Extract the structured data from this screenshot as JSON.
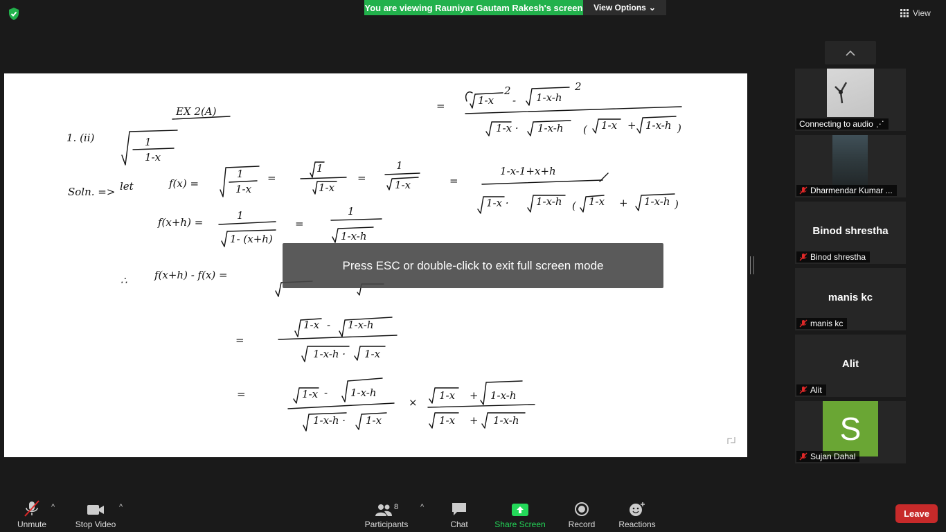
{
  "meeting": {
    "banner_text": "You are viewing Rauniyar Gautam Rakesh's screen",
    "view_options_label": "View Options",
    "view_label": "View",
    "fullscreen_hint": "Press ESC or double-click to exit full screen mode"
  },
  "whiteboard": {
    "title": "EX 2(A)",
    "problem_num": "1. (ii)",
    "expr_given": "√(1/(1-x))",
    "sol_label": "Soln. =>",
    "let_label": "let",
    "lines": [
      "f(x) = √(1/(1-x)) = √1/√(1-x) = 1/√(1-x)",
      "f(x+h) = 1/√(1-(x+h)) = 1/√(1-x-h)",
      "∴ f(x+h) - f(x) = 1/√(1-x-h) - 1/√(1-x)",
      "= (√(1-x) - √(1-x-h)) / (√(1-x-h) · √(1-x))",
      "= (√(1-x) - √(1-x-h))/(√(1-x-h)·√(1-x)) × (√(1-x) + √(1-x-h))/(√(1-x) + √(1-x-h))",
      "= ((√(1-x))² - (√(1-x-h))²) / (√(1-x)·√(1-x-h)(√(1-x)+√(1-x-h)))",
      "= (1-x-1+x+h) / (√(1-x)·√(1-x-h)(√(1-x)+√(1-x-h)))"
    ]
  },
  "participants_panel": {
    "tiles": [
      {
        "name": "Connecting to audio",
        "show_name": ""
      },
      {
        "name": "Dharmendar Kumar ...",
        "show_name": ""
      },
      {
        "name": "Binod shrestha",
        "show_name": "Binod shrestha"
      },
      {
        "name": "manis kc",
        "show_name": "manis kc"
      },
      {
        "name": "Alit",
        "show_name": "Alit"
      },
      {
        "name": "Sujan Dahal",
        "show_name": "",
        "initial": "S"
      }
    ]
  },
  "toolbar": {
    "unmute": "Unmute",
    "stop_video": "Stop Video",
    "participants": "Participants",
    "participants_count": "8",
    "chat": "Chat",
    "share_screen": "Share Screen",
    "record": "Record",
    "reactions": "Reactions",
    "leave": "Leave"
  },
  "colors": {
    "banner_green": "#22b14c",
    "share_green": "#23d959",
    "leave_red": "#c72a2a",
    "avatar_green": "#6aa634",
    "muted_red": "#e02828"
  }
}
